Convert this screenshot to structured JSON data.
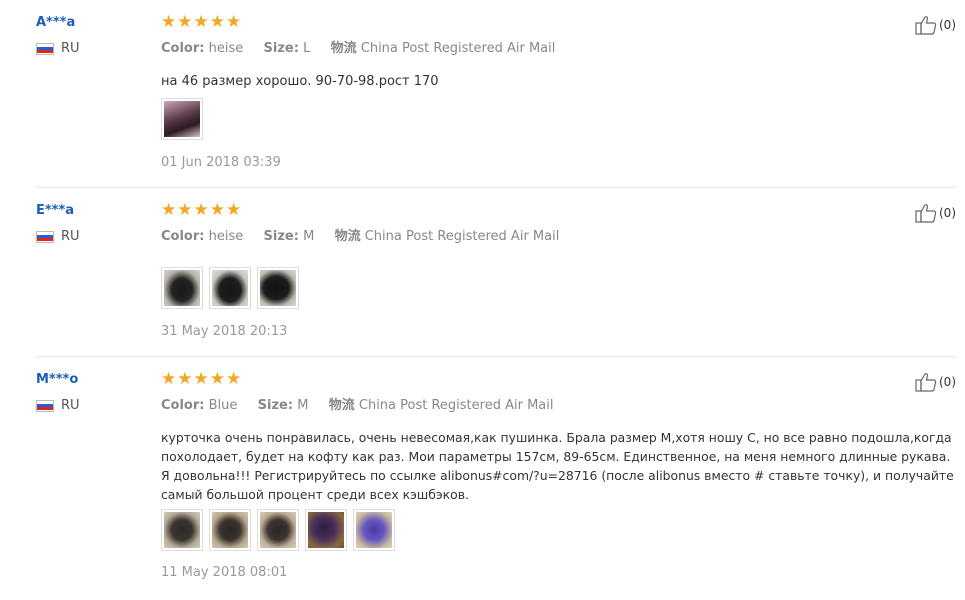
{
  "reviews": [
    {
      "user": "A***a",
      "country": "RU",
      "stars": "★★★★★",
      "color_label": "Color:",
      "color_value": "heise",
      "size_label": "Size:",
      "size_value": "L",
      "shipping_label": "物流",
      "shipping_value": "China Post Registered Air Mail",
      "text": "на 46 размер хорошо. 90-70-98.рост 170",
      "date": "01 Jun 2018 03:39",
      "likes": "(0)"
    },
    {
      "user": "E***a",
      "country": "RU",
      "stars": "★★★★★",
      "color_label": "Color:",
      "color_value": "heise",
      "size_label": "Size:",
      "size_value": "M",
      "shipping_label": "物流",
      "shipping_value": "China Post Registered Air Mail",
      "text": "",
      "date": "31 May 2018 20:13",
      "likes": "(0)"
    },
    {
      "user": "M***o",
      "country": "RU",
      "stars": "★★★★★",
      "color_label": "Color:",
      "color_value": "Blue",
      "size_label": "Size:",
      "size_value": "M",
      "shipping_label": "物流",
      "shipping_value": "China Post Registered Air Mail",
      "text": "курточка очень понравилась, очень невесомая,как пушинка. Брала размер М,хотя ношу С, но все равно подошла,когда похолодает, будет на кофту как раз. Мои параметры 157см, 89-65см. Единственное, на меня немного длинные рукава. Я довольна!!! Регистрируйтесь по ссылке alibonus#com/?u=28716 (после alibonus вместо # ставьте точку), и получайте самый большой процент среди всех кэшбэков.",
      "date": "11 May 2018 08:01",
      "likes": "(0)"
    }
  ]
}
